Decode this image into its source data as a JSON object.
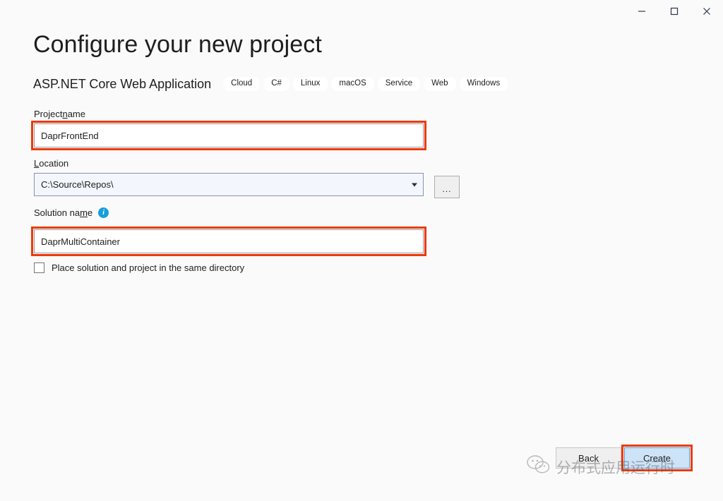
{
  "window": {
    "controls": [
      {
        "name": "minimize",
        "glyph": "minimize-icon"
      },
      {
        "name": "maximize",
        "glyph": "maximize-icon"
      },
      {
        "name": "close",
        "glyph": "close-icon"
      }
    ]
  },
  "header": {
    "title": "Configure your new project",
    "template_name": "ASP.NET Core Web Application",
    "tags": [
      "Cloud",
      "C#",
      "Linux",
      "macOS",
      "Service",
      "Web",
      "Windows"
    ]
  },
  "form": {
    "project_name": {
      "label_before": "Project ",
      "label_accel": "n",
      "label_after": "ame",
      "value": "DaprFrontEnd",
      "placeholder": ""
    },
    "location": {
      "label_accel": "L",
      "label_after": "ocation",
      "value": "C:\\Source\\Repos\\",
      "placeholder": "",
      "browse_label": "..."
    },
    "solution_name": {
      "label_before": "Solution na",
      "label_accel": "m",
      "label_after": "e",
      "value": "DaprMultiContainer",
      "placeholder": "",
      "info_glyph": "i"
    },
    "same_directory": {
      "label_before": "Place solution and project in the same ",
      "label_accel": "d",
      "label_after": "irectory",
      "checked": false
    }
  },
  "footer": {
    "back_label": "Back",
    "create_label": "Create"
  },
  "watermark": {
    "text": "分布式应用运行时"
  },
  "colors": {
    "annotation_red": "#ea3b0c",
    "accent_blue": "#179fdb",
    "create_fill": "#cde3f7",
    "create_border": "#5b9bd5",
    "page_bg": "#fafafa"
  }
}
